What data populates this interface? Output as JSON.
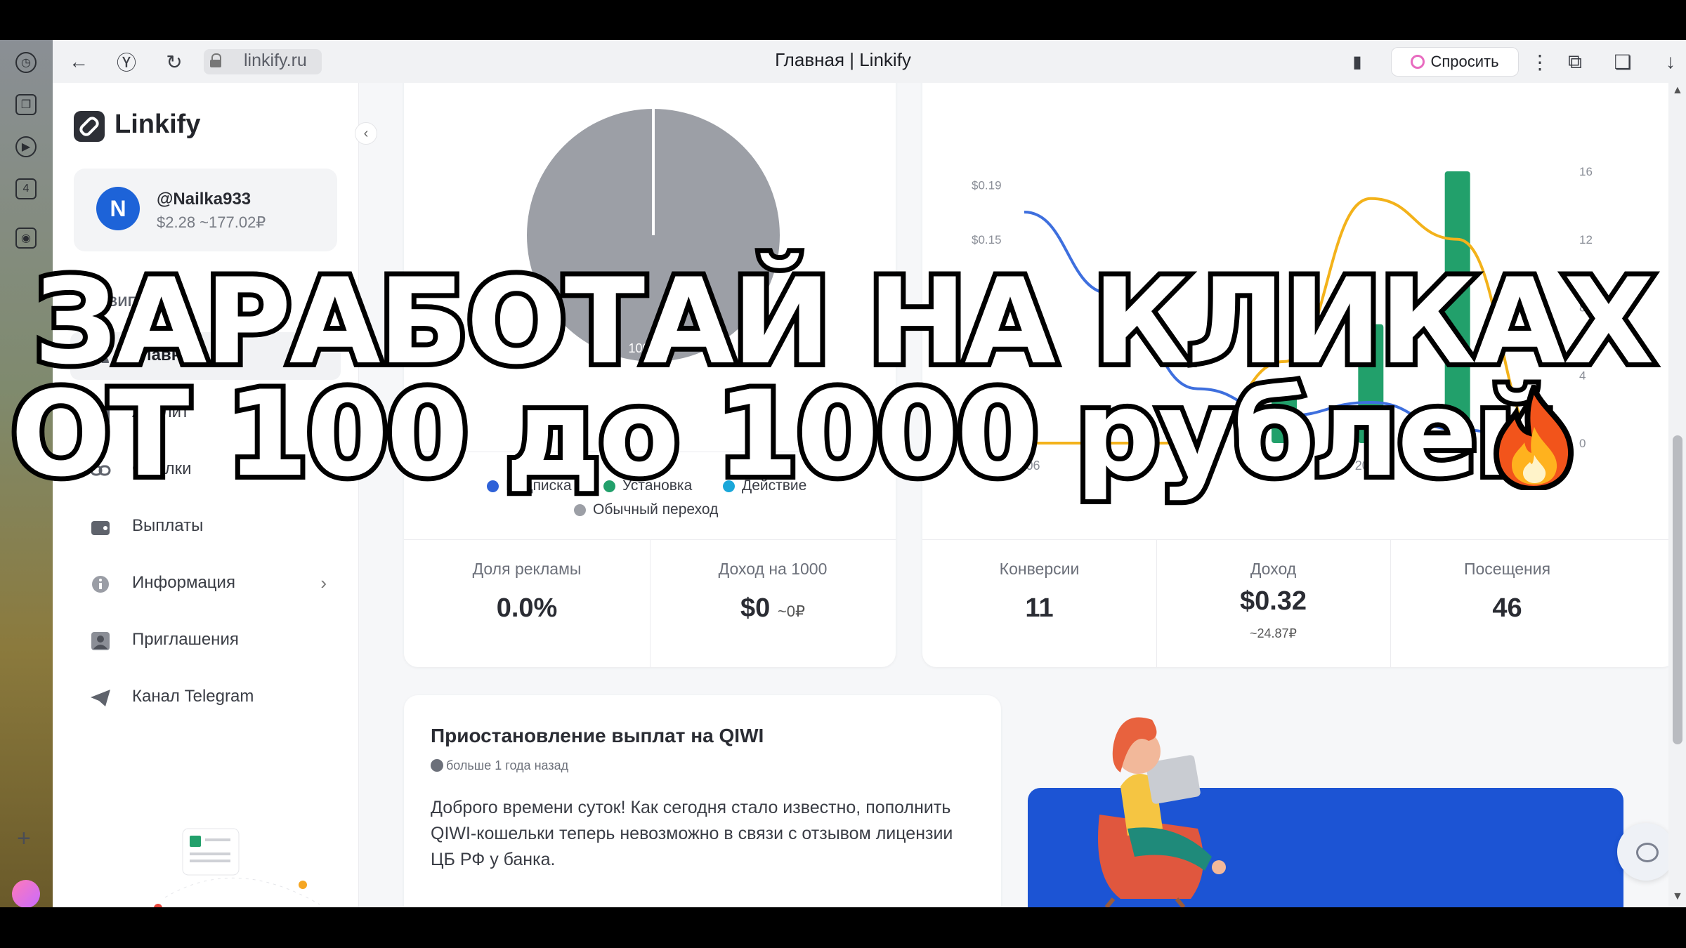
{
  "browser": {
    "url": "linkify.ru",
    "tab_title": "Главная | Linkify",
    "ask_label": "Спросить"
  },
  "app": {
    "logo": "Linkify",
    "user": {
      "initial": "N",
      "name": "@Nailka933",
      "balance": "$2.28 ~177.02₽"
    },
    "nav_heading": "НАВИГАЦИЯ",
    "nav_items": [
      {
        "label": "Главная",
        "icon": "dashboard-icon",
        "active": true
      },
      {
        "label": "Аналит",
        "icon": "analytics-icon"
      },
      {
        "label": "Ссылки",
        "icon": "link-icon"
      },
      {
        "label": "Выплаты",
        "icon": "wallet-icon"
      },
      {
        "label": "Информация",
        "icon": "info-icon",
        "has_chevron": true
      },
      {
        "label": "Приглашения",
        "icon": "user-icon"
      },
      {
        "label": "Канал Telegram",
        "icon": "telegram-icon"
      }
    ],
    "header_avatar": "N"
  },
  "pie_card": {
    "pie_label": "100.0%",
    "legend": [
      {
        "label": "Подписка",
        "color": "#2f62d8"
      },
      {
        "label": "Установка",
        "color": "#22a06b"
      },
      {
        "label": "Действие",
        "color": "#1aa7d9"
      },
      {
        "label": "Обычный переход",
        "color": "#9c9fa6"
      }
    ],
    "stats": [
      {
        "label": "Доля рекламы",
        "value": "0.0%"
      },
      {
        "label": "Доход на 1000",
        "value": "$0",
        "sub": "~0₽"
      }
    ]
  },
  "chart_data": {
    "type": "line",
    "categories": [
      "16.06",
      "17.06",
      "18.06",
      "19.06",
      "20.06",
      "21.06",
      "22.06"
    ],
    "left_ticks": [
      "$0.19",
      "$0.15"
    ],
    "right_ticks": [
      "16",
      "12",
      "8",
      "4",
      "0"
    ],
    "ylim_right": [
      0,
      16
    ],
    "series": [
      {
        "type": "line",
        "color": "#3e6fde",
        "values": [
          0.17,
          0.11,
          0.04,
          0.02,
          0.03,
          0.01,
          0.0
        ]
      },
      {
        "type": "line",
        "color": "#f3b21a",
        "values": [
          0.0,
          0.0,
          0.0,
          0.06,
          0.18,
          0.15,
          0.0
        ]
      },
      {
        "type": "bar",
        "color": "#22a06b",
        "values": [
          0,
          0,
          0,
          3,
          7,
          16,
          0
        ]
      }
    ],
    "grid": false
  },
  "stats_right": [
    {
      "label": "Конверсии",
      "value": "11"
    },
    {
      "label": "Доход",
      "value": "$0.32",
      "sub": "~24.87₽"
    },
    {
      "label": "Посещения",
      "value": "46"
    }
  ],
  "news": {
    "title": "Приостановление выплат на QIWI",
    "time": "больше 1 года назад",
    "body": "Доброго времени суток! Как сегодня стало известно, пополнить QIWI-кошельки теперь невозможно в связи с отзывом лицензии ЦБ РФ у банка."
  },
  "overlay": {
    "line1": "ЗАРАБОТАЙ НА КЛИКАХ",
    "line2": "ОТ 100 до 1000 рублей",
    "emoji_icon": "fire-icon"
  }
}
